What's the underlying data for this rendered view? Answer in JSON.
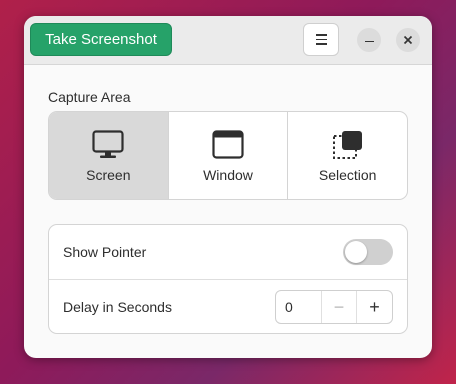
{
  "header": {
    "take_screenshot_label": "Take Screenshot",
    "menu_icon": "hamburger-menu-icon",
    "minimize_icon": "minimize-icon",
    "close_icon": "close-icon"
  },
  "capture_area": {
    "label": "Capture Area",
    "modes": [
      {
        "label": "Screen",
        "icon": "monitor-icon",
        "selected": true
      },
      {
        "label": "Window",
        "icon": "window-icon",
        "selected": false
      },
      {
        "label": "Selection",
        "icon": "selection-icon",
        "selected": false
      }
    ]
  },
  "options": {
    "show_pointer_label": "Show Pointer",
    "show_pointer_enabled": false,
    "delay_label": "Delay in Seconds",
    "delay_value": "0",
    "decrement_label": "−",
    "increment_label": "+"
  },
  "colors": {
    "accent_green": "#26a269",
    "selected_mode_bg": "#d9d9d9"
  }
}
